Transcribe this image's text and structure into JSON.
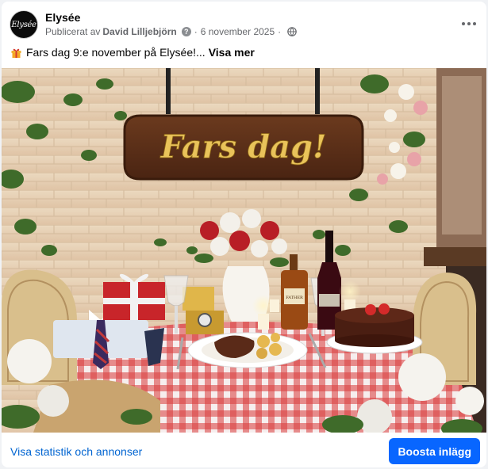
{
  "post": {
    "page_name": "Elysée",
    "avatar_text": "Elysée",
    "published_by_prefix": "Publicerat av",
    "author": "David Lilljebjörn",
    "date": "6 november 2025",
    "info_icon": "question-icon",
    "audience_icon": "globe-icon",
    "more_icon": "more-options-icon",
    "caption_icon": "gift-icon",
    "caption_text": "Fars dag 9:e november på Elysée!...",
    "see_more": "Visa mer"
  },
  "photo": {
    "sign_text": "Fars dag!",
    "bottle_label": "FATHER"
  },
  "footer": {
    "stats_link": "Visa statistik och annonser",
    "boost_button": "Boosta inlägg"
  },
  "colors": {
    "accent": "#0866ff",
    "link": "#0064d1",
    "secondary_text": "#65676b"
  }
}
